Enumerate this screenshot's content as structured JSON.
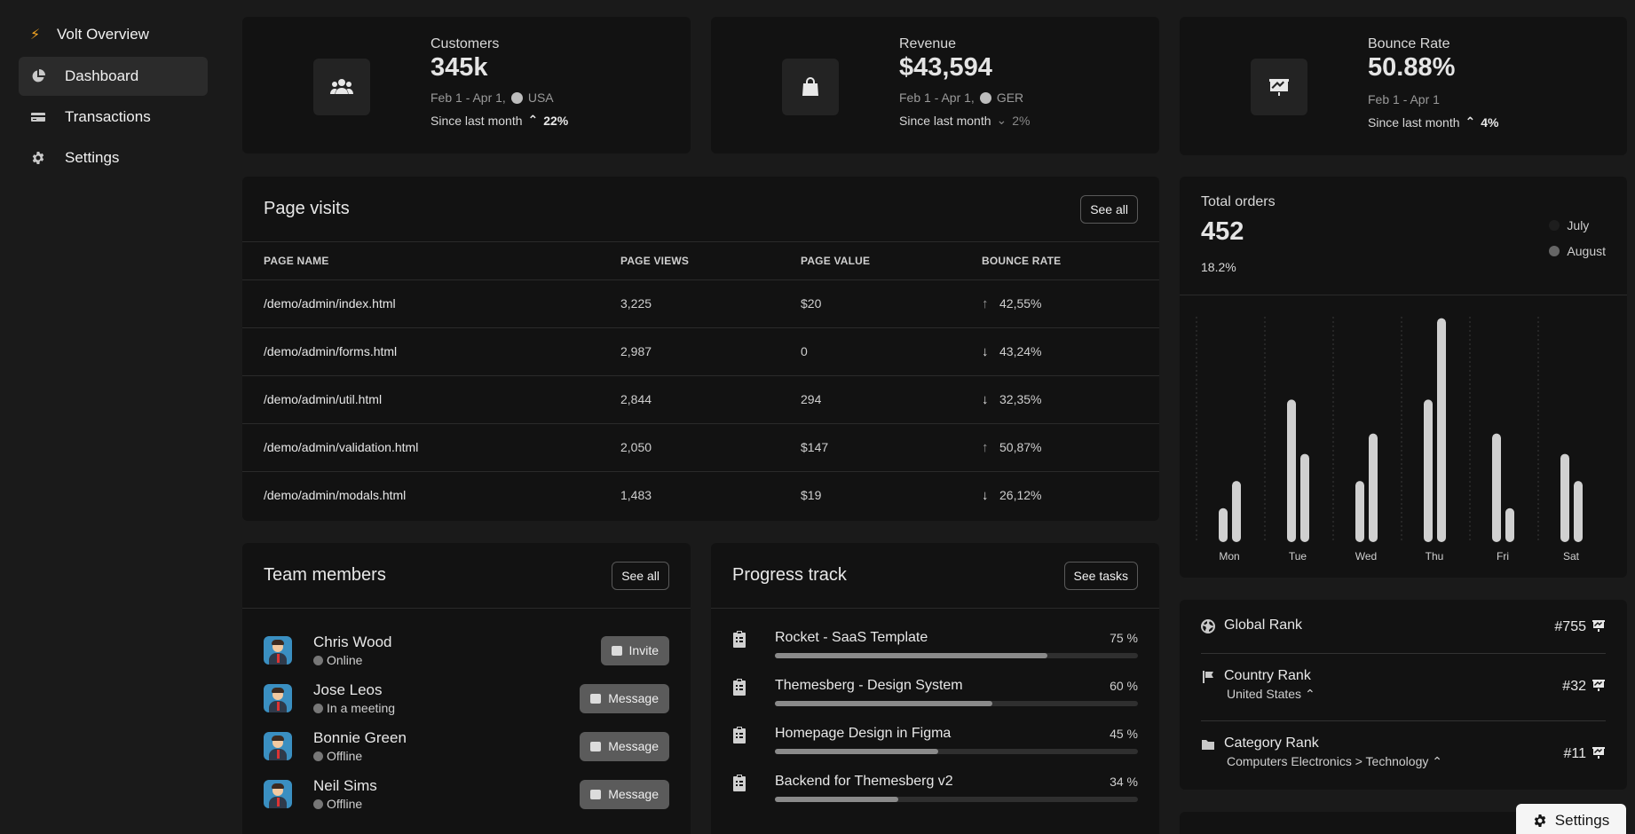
{
  "sidebar": {
    "brand": "Volt Overview",
    "items": [
      {
        "label": "Dashboard",
        "icon": "pie-chart-icon",
        "active": true
      },
      {
        "label": "Transactions",
        "icon": "credit-card-icon"
      },
      {
        "label": "Settings",
        "icon": "gear-icon"
      }
    ]
  },
  "stats": [
    {
      "label": "Customers",
      "value": "345k",
      "period": "Feb 1 - Apr 1,",
      "region": "USA",
      "since": "Since last month",
      "change": "22%",
      "direction": "up",
      "icon": "users-icon"
    },
    {
      "label": "Revenue",
      "value": "$43,594",
      "period": "Feb 1 - Apr 1,",
      "region": "GER",
      "since": "Since last month",
      "change": "2%",
      "direction": "down",
      "icon": "shopping-bag-icon"
    },
    {
      "label": "Bounce Rate",
      "value": "50.88%",
      "period": "Feb 1 - Apr 1",
      "region": "",
      "since": "Since last month",
      "change": "4%",
      "direction": "up",
      "icon": "presentation-chart-icon"
    }
  ],
  "page_visits": {
    "title": "Page visits",
    "see_all": "See all",
    "columns": [
      "PAGE NAME",
      "PAGE VIEWS",
      "PAGE VALUE",
      "BOUNCE RATE"
    ],
    "rows": [
      {
        "name": "/demo/admin/index.html",
        "views": "3,225",
        "value": "$20",
        "bounce": "42,55%",
        "direction": "up"
      },
      {
        "name": "/demo/admin/forms.html",
        "views": "2,987",
        "value": "0",
        "bounce": "43,24%",
        "direction": "down"
      },
      {
        "name": "/demo/admin/util.html",
        "views": "2,844",
        "value": "294",
        "bounce": "32,35%",
        "direction": "down"
      },
      {
        "name": "/demo/admin/validation.html",
        "views": "2,050",
        "value": "$147",
        "bounce": "50,87%",
        "direction": "up"
      },
      {
        "name": "/demo/admin/modals.html",
        "views": "1,483",
        "value": "$19",
        "bounce": "26,12%",
        "direction": "down"
      }
    ]
  },
  "team": {
    "title": "Team members",
    "see_all": "See all",
    "members": [
      {
        "name": "Chris Wood",
        "status": "Online",
        "action": "Invite"
      },
      {
        "name": "Jose Leos",
        "status": "In a meeting",
        "action": "Message"
      },
      {
        "name": "Bonnie Green",
        "status": "Offline",
        "action": "Message"
      },
      {
        "name": "Neil Sims",
        "status": "Offline",
        "action": "Message"
      }
    ]
  },
  "progress": {
    "title": "Progress track",
    "see_tasks": "See tasks",
    "items": [
      {
        "title": "Rocket - SaaS Template",
        "percent_label": "75 %",
        "percent": 75
      },
      {
        "title": "Themesberg - Design System",
        "percent_label": "60 %",
        "percent": 60
      },
      {
        "title": "Homepage Design in Figma",
        "percent_label": "45 %",
        "percent": 45
      },
      {
        "title": "Backend for Themesberg v2",
        "percent_label": "34 %",
        "percent": 34
      }
    ]
  },
  "orders": {
    "label": "Total orders",
    "value": "452",
    "percent": "18.2%",
    "legend": [
      {
        "name": "July",
        "color": "#1e1e1e"
      },
      {
        "name": "August",
        "color": "#666666"
      }
    ]
  },
  "chart_data": {
    "type": "bar",
    "categories": [
      "Mon",
      "Tue",
      "Wed",
      "Thu",
      "Fri",
      "Sat"
    ],
    "series": [
      {
        "name": "July",
        "values": [
          5,
          21,
          9,
          21,
          16,
          13
        ]
      },
      {
        "name": "August",
        "values": [
          9,
          13,
          16,
          33,
          5,
          9
        ]
      }
    ],
    "ylim": [
      0,
      34
    ],
    "grid": "vertical-dotted",
    "legend": "top-right",
    "bar_color": "#d0d0d0"
  },
  "ranks": [
    {
      "title": "Global Rank",
      "sub": "",
      "value": "#755",
      "icon": "globe-icon"
    },
    {
      "title": "Country Rank",
      "sub": "United States",
      "value": "#32",
      "icon": "flag-icon"
    },
    {
      "title": "Category Rank",
      "sub": "Computers Electronics > Technology",
      "value": "#11",
      "icon": "folder-icon"
    }
  ],
  "floating_settings": {
    "label": "Settings"
  },
  "colors": {
    "background": "#1a1a1a",
    "card": "#121212",
    "accent": "#f5a623"
  }
}
